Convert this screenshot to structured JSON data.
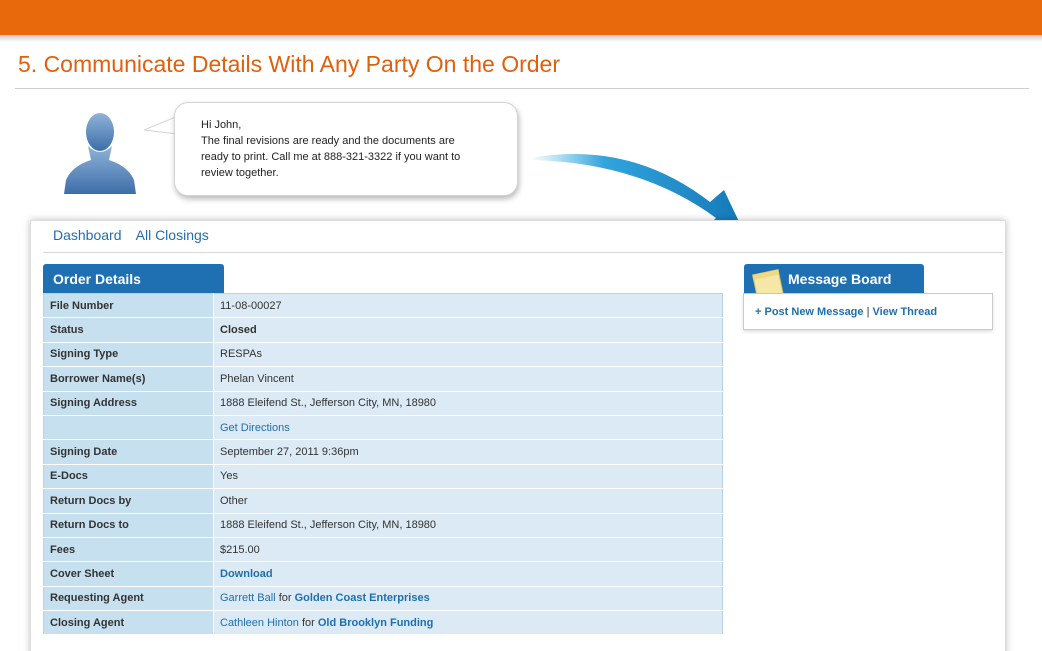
{
  "heading": "5. Communicate Details With Any Party On the Order",
  "message_bubble": {
    "lines": [
      "Hi John,",
      "The final revisions are ready and the documents are",
      "ready to print.  Call me at 888-321-3322 if you want to",
      "review together."
    ]
  },
  "nav": {
    "links": [
      "Dashboard",
      "All Closings"
    ]
  },
  "order_details": {
    "title": "Order Details",
    "rows": [
      {
        "label": "File Number",
        "value": "11-08-00027"
      },
      {
        "label": "Status",
        "value": "Closed"
      },
      {
        "label": "Signing Type",
        "value": "RESPAs"
      },
      {
        "label": "Borrower Name(s)",
        "value": "Phelan Vincent"
      },
      {
        "label": "Signing Address",
        "value": "1888 Eleifend St., Jefferson City, MN, 18980"
      },
      {
        "label": "",
        "link": "Get Directions"
      },
      {
        "label": "Signing Date",
        "value": "September 27, 2011 9:36pm"
      },
      {
        "label": "E-Docs",
        "value": "Yes"
      },
      {
        "label": "Return Docs by",
        "value": "Other"
      },
      {
        "label": "Return Docs to",
        "value": "1888 Eleifend St., Jefferson City, MN, 18980"
      },
      {
        "label": "Fees",
        "value": "$215.00"
      },
      {
        "label": "Cover Sheet",
        "link": "Download"
      },
      {
        "label": "Requesting Agent",
        "agent": "Garrett Ball",
        "connector": "for",
        "company": "Golden Coast Enterprises"
      },
      {
        "label": "Closing Agent",
        "agent": "Cathleen Hinton",
        "connector": "for",
        "company": "Old Brooklyn Funding"
      }
    ]
  },
  "message_board": {
    "title": "Message Board",
    "post_link": "+ Post New Message",
    "separator": "|",
    "view_link": "View Thread"
  },
  "colors": {
    "orange_bar": "#e8690c",
    "heading_orange": "#e25f0b",
    "tab_blue": "#1f70b2",
    "link_blue": "#1f6fae",
    "label_cell": "#c7e0ef",
    "value_cell": "#dbeaf4"
  },
  "icons": [
    "user-avatar-icon",
    "speech-bubble-tail",
    "curved-arrow-icon",
    "sticky-note-icon"
  ]
}
